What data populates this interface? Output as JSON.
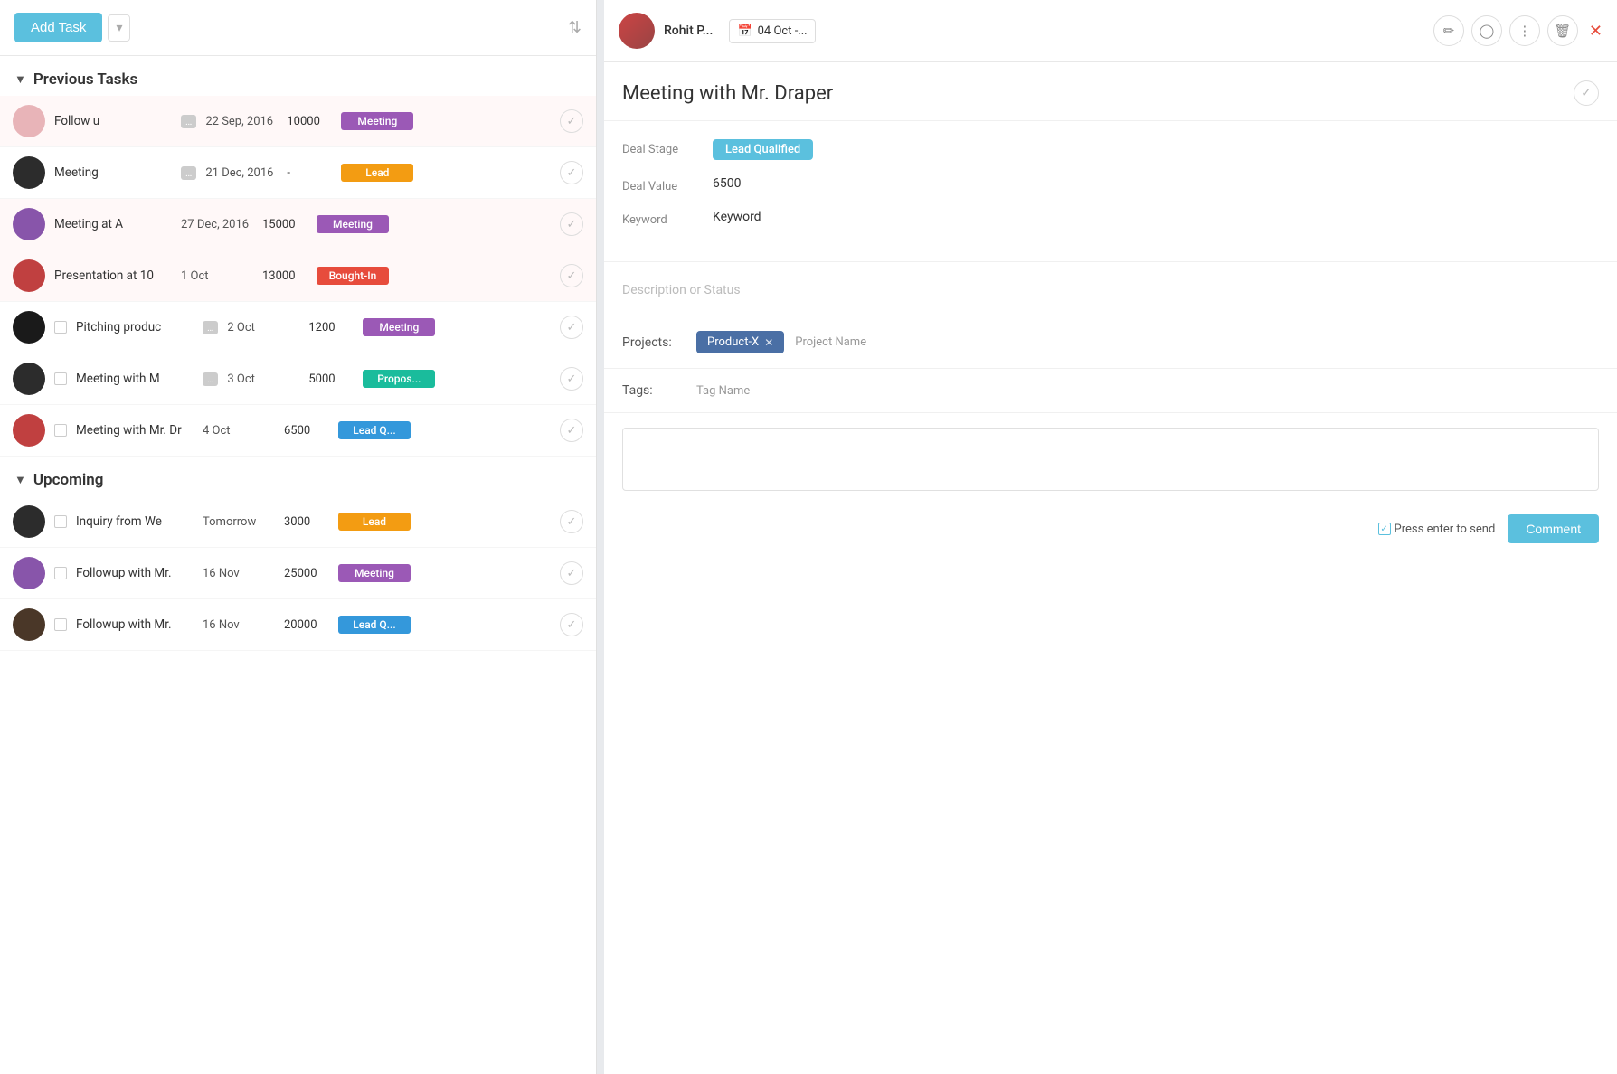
{
  "toolbar": {
    "add_task_label": "Add Task",
    "sort_icon": "⇅"
  },
  "previous_tasks": {
    "section_label": "Previous Tasks",
    "tasks": [
      {
        "id": 1,
        "name": "Follow u",
        "has_dots": true,
        "date": "22 Sep, 2016",
        "value": "10000",
        "tag_label": "Meeting",
        "tag_type": "meeting",
        "avatar_class": "fa-pink",
        "highlighted": true
      },
      {
        "id": 2,
        "name": "Meeting",
        "has_dots": true,
        "date": "21 Dec, 2016",
        "value": "-",
        "tag_label": "Lead",
        "tag_type": "lead",
        "avatar_class": "fa-dark",
        "highlighted": false
      },
      {
        "id": 3,
        "name": "Meeting at A",
        "has_dots": false,
        "date": "27 Dec, 2016",
        "value": "15000",
        "tag_label": "Meeting",
        "tag_type": "meeting",
        "avatar_class": "fa-purple",
        "highlighted": true
      },
      {
        "id": 4,
        "name": "Presentation at 10",
        "has_dots": false,
        "date": "1 Oct",
        "value": "13000",
        "tag_label": "Bought-In",
        "tag_type": "bought-in",
        "avatar_class": "fa-red",
        "highlighted": true
      },
      {
        "id": 5,
        "name": "Pitching produc",
        "has_dots": true,
        "date": "2 Oct",
        "value": "1200",
        "tag_label": "Meeting",
        "tag_type": "meeting",
        "avatar_class": "fa-black",
        "highlighted": false
      },
      {
        "id": 6,
        "name": "Meeting with M",
        "has_dots": true,
        "date": "3 Oct",
        "value": "5000",
        "tag_label": "Propos...",
        "tag_type": "propos",
        "avatar_class": "fa-dark",
        "highlighted": false
      },
      {
        "id": 7,
        "name": "Meeting with Mr. Dr",
        "has_dots": false,
        "date": "4 Oct",
        "value": "6500",
        "tag_label": "Lead Q...",
        "tag_type": "lead-q",
        "avatar_class": "fa-red",
        "highlighted": false
      }
    ]
  },
  "upcoming_tasks": {
    "section_label": "Upcoming",
    "tasks": [
      {
        "id": 8,
        "name": "Inquiry from We",
        "has_dots": false,
        "date": "Tomorrow",
        "value": "3000",
        "tag_label": "Lead",
        "tag_type": "lead",
        "avatar_class": "fa-dark",
        "highlighted": false
      },
      {
        "id": 9,
        "name": "Followup with Mr.",
        "has_dots": false,
        "date": "16 Nov",
        "value": "25000",
        "tag_label": "Meeting",
        "tag_type": "meeting",
        "avatar_class": "fa-purple",
        "highlighted": false
      },
      {
        "id": 10,
        "name": "Followup with Mr.",
        "has_dots": false,
        "date": "16 Nov",
        "value": "20000",
        "tag_label": "Lead Q...",
        "tag_type": "lead-q",
        "avatar_class": "fa-brown",
        "highlighted": false
      }
    ]
  },
  "detail": {
    "user_name": "Rohit P...",
    "date_label": "04 Oct -...",
    "title": "Meeting with Mr. Draper",
    "deal_stage_label": "Deal Stage",
    "deal_stage_value": "Lead Qualified",
    "deal_value_label": "Deal Value",
    "deal_value": "6500",
    "keyword_label": "Keyword",
    "keyword_value": "Keyword",
    "description_placeholder": "Description or Status",
    "projects_label": "Projects:",
    "project_tag": "Product-X",
    "project_placeholder": "Project Name",
    "tags_label": "Tags:",
    "tags_placeholder": "Tag Name",
    "press_enter_label": "Press enter to send",
    "comment_btn_label": "Comment",
    "calendar_icon": "📅",
    "pencil_icon": "✏",
    "circle_icon": "⬤",
    "dots_icon": "⋮",
    "trash_icon": "🗑",
    "close_icon": "✕",
    "check_icon": "✓"
  }
}
